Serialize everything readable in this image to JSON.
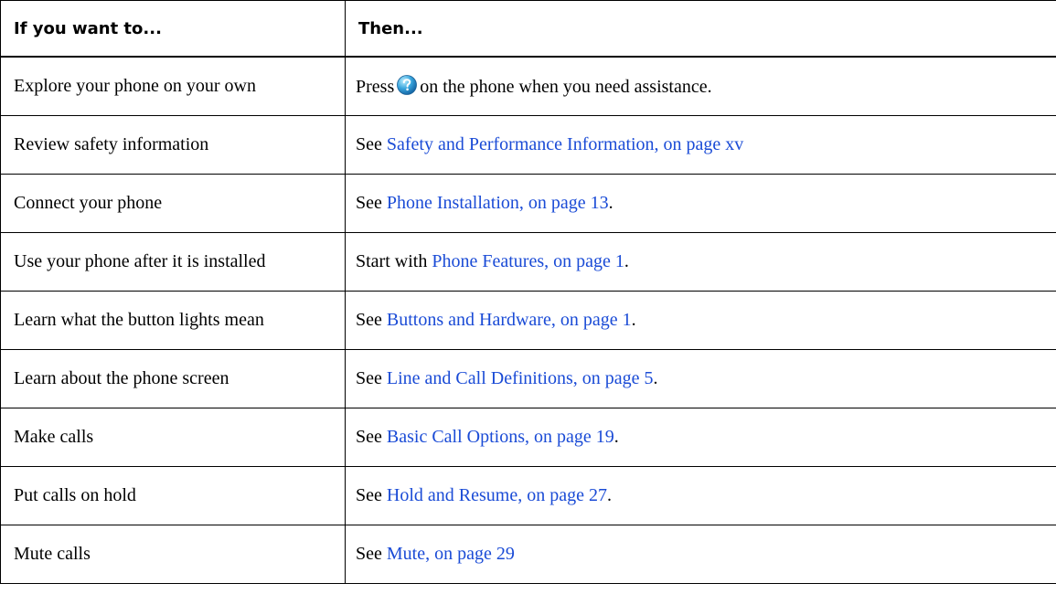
{
  "table": {
    "headers": {
      "col1": "If you want to...",
      "col2": "Then..."
    },
    "rows": [
      {
        "task": "Explore your phone on your own",
        "prefix": "Press",
        "icon": "help-icon",
        "link": "",
        "suffix": "on the phone when you need assistance."
      },
      {
        "task": "Review safety information",
        "prefix": "See",
        "link": "Safety and Performance Information,  on page xv",
        "suffix": ""
      },
      {
        "task": "Connect your phone",
        "prefix": "See",
        "link": "Phone Installation,  on page 13",
        "suffix": "."
      },
      {
        "task": "Use your phone after it is installed",
        "prefix": "Start with",
        "link": "Phone Features,  on page 1",
        "suffix": "."
      },
      {
        "task": "Learn what the button lights mean",
        "prefix": "See",
        "link": "Buttons and Hardware,  on page 1",
        "suffix": "."
      },
      {
        "task": "Learn about the phone screen",
        "prefix": "See",
        "link": "Line and Call Definitions,  on page 5",
        "suffix": "."
      },
      {
        "task": "Make calls",
        "prefix": "See",
        "link": "Basic Call Options,  on page 19",
        "suffix": "."
      },
      {
        "task": "Put calls on hold",
        "prefix": "See",
        "link": "Hold and Resume,  on page 27",
        "suffix": "."
      },
      {
        "task": "Mute calls",
        "prefix": "See",
        "link": "Mute,  on page 29",
        "suffix": ""
      }
    ]
  },
  "colors": {
    "link": "#1a4bd6",
    "border": "#000000",
    "text": "#000000"
  }
}
